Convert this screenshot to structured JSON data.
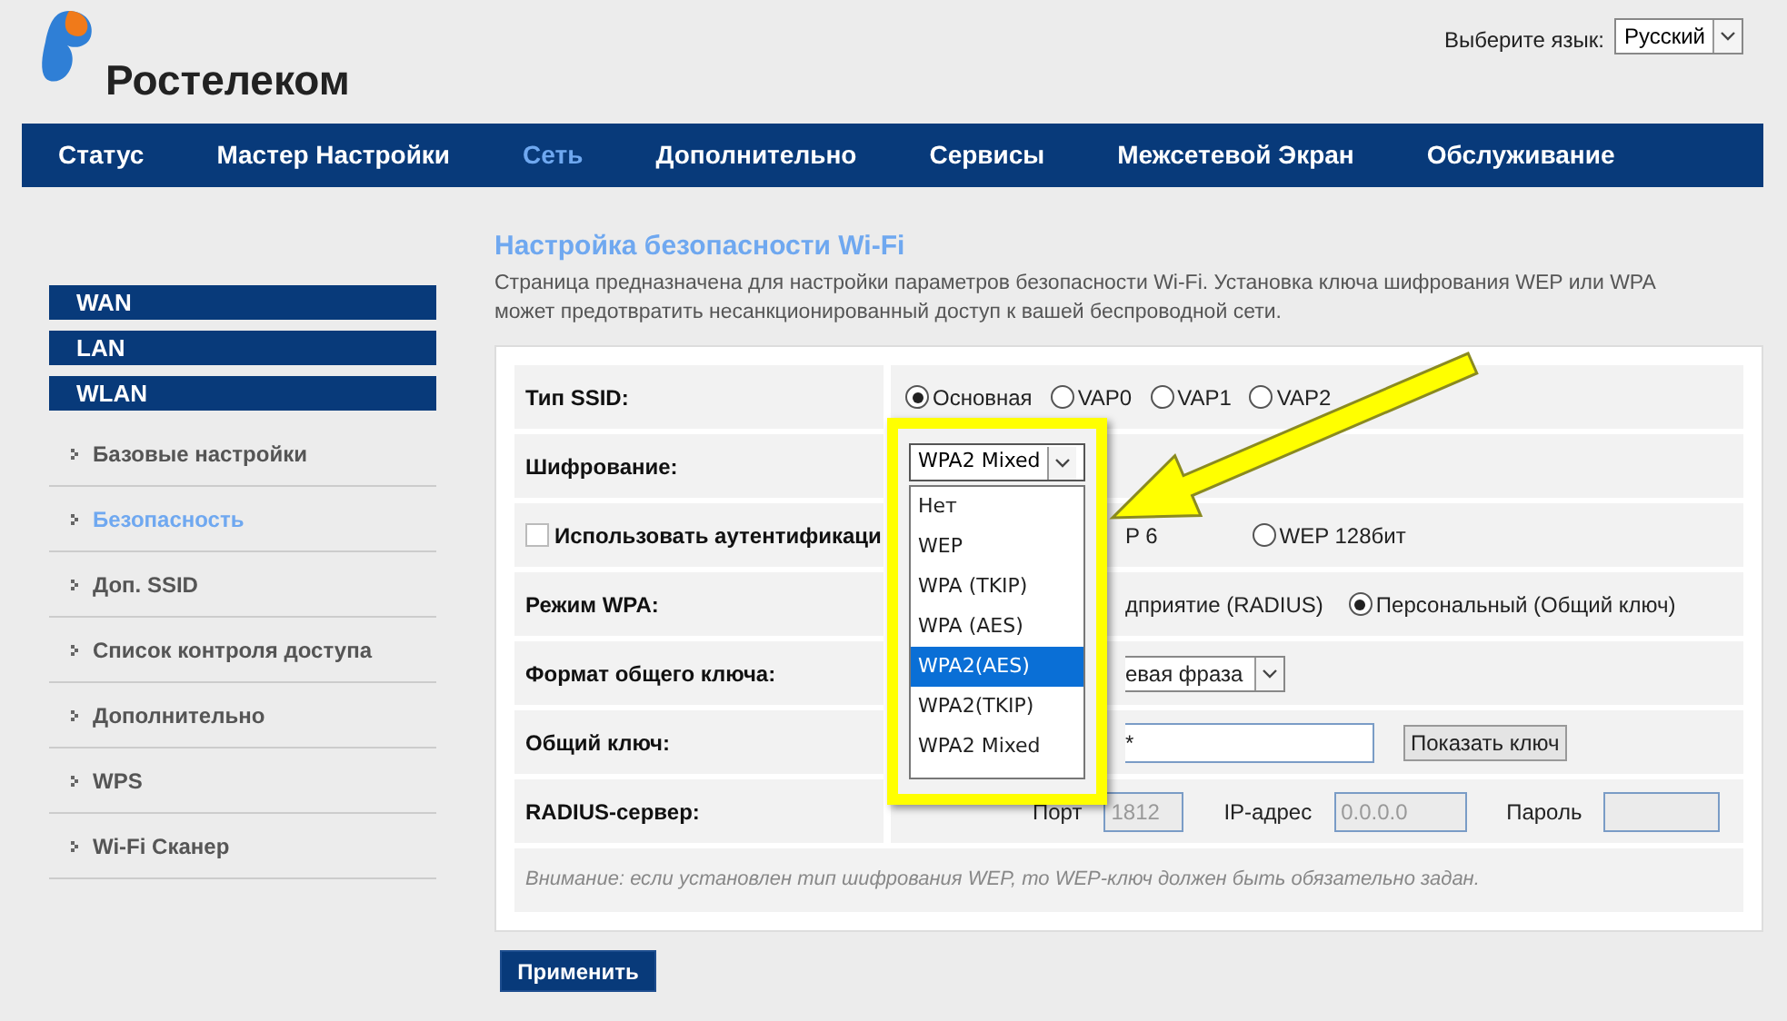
{
  "header": {
    "logo_text": "Ростелеком",
    "language_label": "Выберите язык:",
    "language_value": "Русский"
  },
  "nav": [
    {
      "label": "Статус",
      "selected": false
    },
    {
      "label": "Мастер Настройки",
      "selected": false
    },
    {
      "label": "Сеть",
      "selected": true
    },
    {
      "label": "Дополнительно",
      "selected": false
    },
    {
      "label": "Сервисы",
      "selected": false
    },
    {
      "label": "Межсетевой Экран",
      "selected": false
    },
    {
      "label": "Обслуживание",
      "selected": false
    }
  ],
  "sidebar": [
    {
      "label": "WAN"
    },
    {
      "label": "LAN"
    },
    {
      "label": "WLAN",
      "children": [
        {
          "label": "Базовые настройки",
          "selected": false
        },
        {
          "label": "Безопасность",
          "selected": true
        },
        {
          "label": "Доп. SSID",
          "selected": false
        },
        {
          "label": "Список контроля доступа",
          "selected": false
        },
        {
          "label": "Дополнительно",
          "selected": false
        },
        {
          "label": "WPS",
          "selected": false
        },
        {
          "label": "Wi-Fi Сканер",
          "selected": false
        }
      ]
    }
  ],
  "page": {
    "title": "Настройка безопасности Wi-Fi",
    "description": "Страница предназначена для настройки параметров безопасности Wi-Fi. Установка ключа шифрования WEP или WPA может предотвратить несанкционированный доступ к вашей беспроводной сети."
  },
  "form": [
    {
      "kind": "radios",
      "label": "Тип SSID:",
      "options": [
        {
          "label": "Основная",
          "selected": true
        },
        {
          "label": "VAP0",
          "selected": false
        },
        {
          "label": "VAP1",
          "selected": false
        },
        {
          "label": "VAP2",
          "selected": false
        }
      ]
    },
    {
      "kind": "dropdown",
      "label": "Шифрование:",
      "value": "WPA2 Mixed",
      "expanded": true,
      "options": [
        {
          "label": "Нет",
          "highlighted": false
        },
        {
          "label": "WEP",
          "highlighted": false
        },
        {
          "label": "WPA (TKIP)",
          "highlighted": false
        },
        {
          "label": "WPA (AES)",
          "highlighted": false
        },
        {
          "label": "WPA2(AES)",
          "highlighted": true
        },
        {
          "label": "WPA2(TKIP)",
          "highlighted": false
        },
        {
          "label": "WPA2 Mixed",
          "highlighted": false
        }
      ]
    },
    {
      "kind": "checkbox-radios",
      "label": "Использовать аутентификаци",
      "checked": false,
      "partial_text": "P 6",
      "options": [
        {
          "label": "WEP 128бит",
          "selected": false
        }
      ]
    },
    {
      "kind": "radios",
      "label": "Режим WPA:",
      "partial_text": "дприятие (RADIUS)",
      "options": [
        {
          "label": "Персональный (Общий ключ)",
          "selected": true
        }
      ]
    },
    {
      "kind": "select",
      "label": "Формат общего ключа:",
      "value": "евая фраза"
    },
    {
      "kind": "password",
      "label": "Общий ключ:",
      "value": "*",
      "button": "Показать ключ"
    },
    {
      "kind": "radius",
      "label": "RADIUS-сервер:",
      "disabled": true,
      "fields": [
        {
          "label": "Порт",
          "value": "1812"
        },
        {
          "label": "IP-адрес",
          "value": "0.0.0.0"
        },
        {
          "label": "Пароль"
        }
      ]
    },
    {
      "kind": "note",
      "text": "Внимание: если установлен тип шифрования WEP, то WEP-ключ должен быть обязательно задан."
    }
  ],
  "apply_button": "Применить"
}
